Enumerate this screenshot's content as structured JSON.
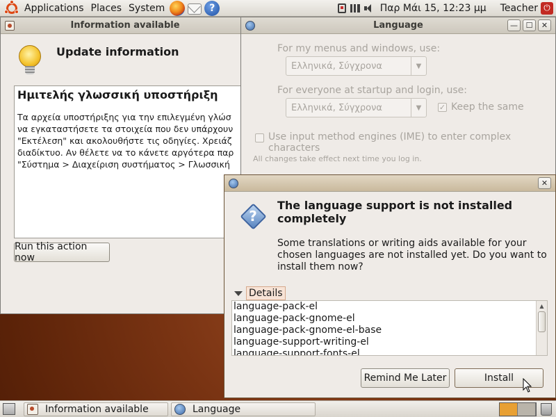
{
  "top_panel": {
    "menus": [
      "Applications",
      "Places",
      "System"
    ],
    "clock": "Παρ Μάι 15, 12:23 μμ",
    "user": "Teacher"
  },
  "info_window": {
    "title": "Information available",
    "heading": "Update information",
    "desc_heading": "Ημιτελής γλωσσική υποστήριξη",
    "desc_lines": [
      "Τα αρχεία υποστήριξης για την επιλεγμένη γλώσ",
      "να εγκαταστήσετε τα στοιχεία που δεν υπάρχουν",
      "\"Εκτέλεση\" και ακολουθήστε τις οδηγίες. Χρειάζ",
      "διαδίκτυο. Αν θέλετε να το κάνετε αργότερα παρ",
      "\"Σύστημα > Διαχείριση συστήματος > Γλωσσική"
    ],
    "run_button": "Run this action now"
  },
  "language_window": {
    "title": "Language",
    "menus_label": "For my menus and windows, use:",
    "menus_value": "Ελληνικά, Σύγχρονα",
    "startup_label": "For everyone at startup and login, use:",
    "startup_value": "Ελληνικά, Σύγχρονα",
    "keep_same": "Keep the same",
    "ime_label": "Use input method engines (IME) to enter complex characters",
    "note": "All changes take effect next time you log in."
  },
  "dialog": {
    "title": "The language support is not installed completely",
    "message": "Some translations or writing aids available for your chosen languages are not installed yet. Do you want to install them now?",
    "details_label": "Details",
    "packages": [
      "language-pack-el",
      "language-pack-gnome-el",
      "language-pack-gnome-el-base",
      "language-support-writing-el",
      "language-support-fonts-el"
    ],
    "remind_button": "Remind Me Later",
    "install_button": "Install"
  },
  "taskbar": {
    "tasks": [
      "Information available",
      "Language"
    ]
  },
  "colors": {
    "accent": "#dd4814",
    "workspace_active": "#e8a033"
  }
}
